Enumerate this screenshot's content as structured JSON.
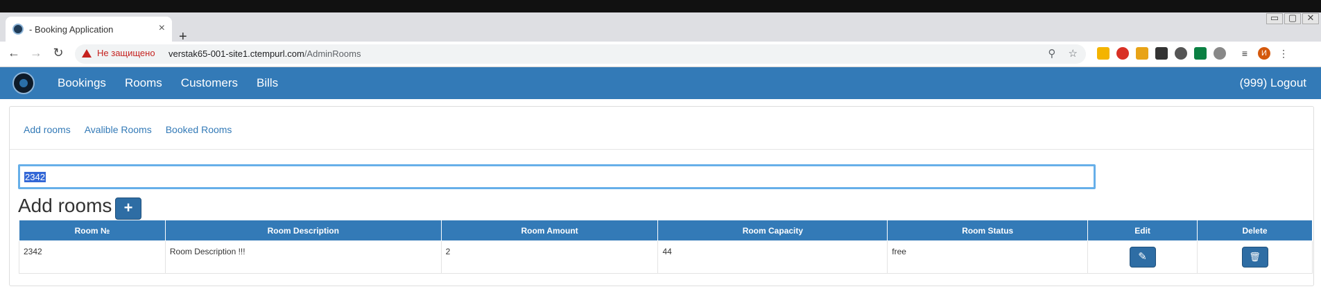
{
  "browser": {
    "tab_title": "- Booking Application",
    "tab_close": "×",
    "new_tab": "+",
    "security_label": "Не защищено",
    "url_host": "verstak65-001-site1.ctempurl.com",
    "url_path": "/AdminRooms",
    "window_controls": [
      "▭",
      "▢",
      "✕"
    ],
    "profile_initial": "И"
  },
  "navbar": {
    "items": [
      "Bookings",
      "Rooms",
      "Customers",
      "Bills"
    ],
    "logout": "(999) Logout"
  },
  "subnav": {
    "items": [
      "Add rooms",
      "Avalible Rooms",
      "Booked Rooms"
    ]
  },
  "search": {
    "value": "2342"
  },
  "page": {
    "heading": "Add rooms",
    "add_button": "+"
  },
  "table": {
    "headers": [
      "Room №",
      "Room Description",
      "Room Amount",
      "Room Capacity",
      "Room Status",
      "Edit",
      "Delete"
    ],
    "rows": [
      {
        "room_no": "2342",
        "description": "Room Description !!!",
        "amount": "2",
        "capacity": "44",
        "status": "free"
      }
    ],
    "edit_icon": "✎",
    "delete_icon": "🗑"
  },
  "colors": {
    "primary": "#337ab7",
    "warning": "#c5221f"
  }
}
